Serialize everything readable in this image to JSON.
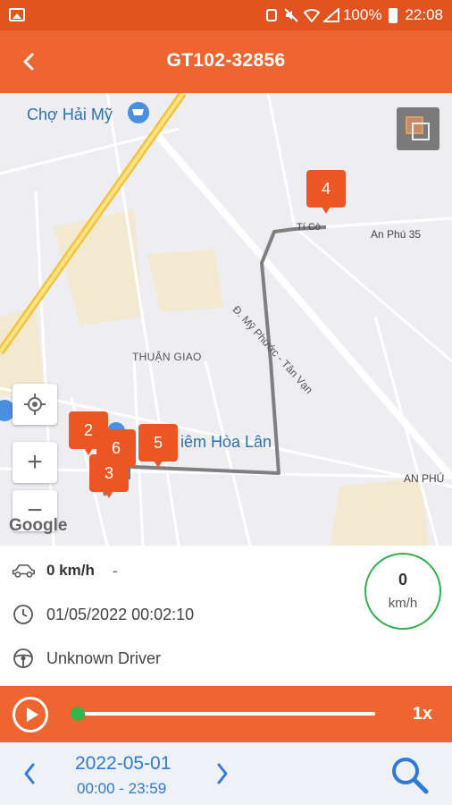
{
  "status_bar": {
    "battery": "100%",
    "time": "22:08"
  },
  "header": {
    "title": "GT102-32856"
  },
  "map": {
    "labels": {
      "market": "Chợ Hải Mỹ",
      "thuan_giao": "THUẬN GIAO",
      "diem": "iêm Hòa Lân",
      "an_phu_35": "An Phú 35",
      "ti_co": "Tí Cò",
      "an_phu": "AN PHÚ",
      "road": "Đ. Mỹ Phước - Tân Vạn"
    },
    "google_logo": "Google",
    "markers": [
      "2",
      "6",
      "3",
      "5",
      "4"
    ]
  },
  "info": {
    "speed": "0 km/h",
    "speed_dash": "-",
    "datetime": "01/05/2022 00:02:10",
    "driver": "Unknown Driver",
    "gauge_value": "0",
    "gauge_unit": "km/h"
  },
  "playback": {
    "progress": 0.0,
    "speed_multiplier": "1x",
    "accent": "#34b44a"
  },
  "footer": {
    "date": "2022-05-01",
    "time_range": "00:00 - 23:59"
  },
  "colors": {
    "primary": "#ef6531",
    "marker": "#ec5524",
    "link": "#2e7ad6"
  }
}
